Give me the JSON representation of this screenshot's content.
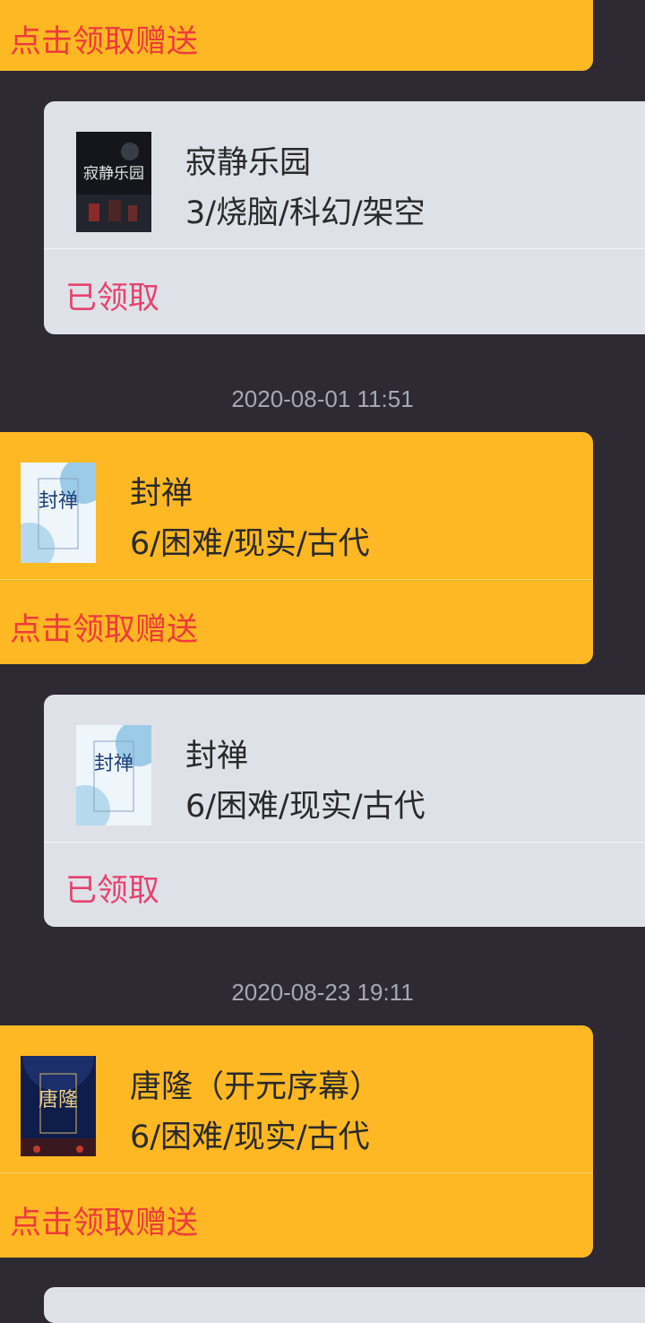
{
  "partial_top_card": {
    "action_label": "点击领取赠送"
  },
  "cards": [
    {
      "kind": "claimed",
      "title": "寂静乐园",
      "meta": "3/烧脑/科幻/架空",
      "action": "已领取",
      "cover_text": "寂静乐园"
    },
    {
      "kind": "gift",
      "timestamp": "2020-08-01 11:51",
      "title": "封禅",
      "meta": "6/困难/现实/古代",
      "action": "点击领取赠送",
      "cover_text": "封禅"
    },
    {
      "kind": "claimed",
      "title": "封禅",
      "meta": "6/困难/现实/古代",
      "action": "已领取",
      "cover_text": "封禅"
    },
    {
      "kind": "gift",
      "timestamp": "2020-08-23 19:11",
      "title": "唐隆（开元序幕）",
      "meta": "6/困难/现实/古代",
      "action": "点击领取赠送",
      "cover_text": "唐隆"
    }
  ],
  "colors": {
    "background": "#2d2a34",
    "gift_card": "#fdb823",
    "claimed_card": "#dfe1e8",
    "gift_action": "#ef3b3b",
    "claimed_action": "#e5436f"
  }
}
